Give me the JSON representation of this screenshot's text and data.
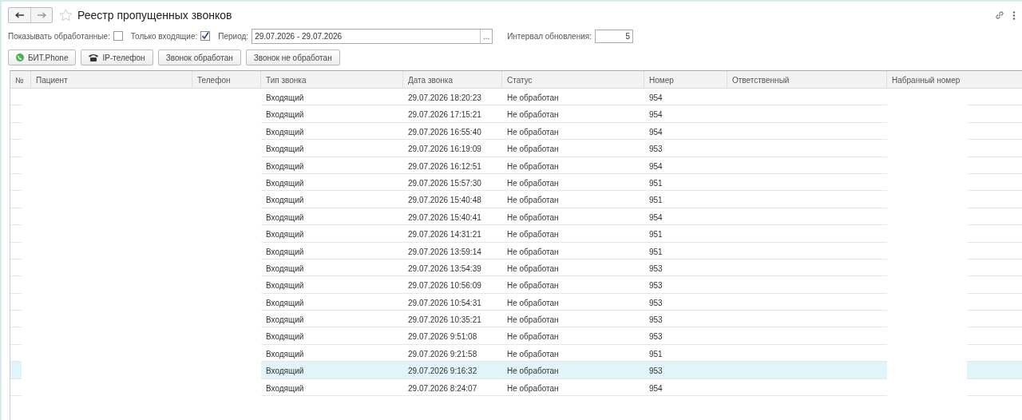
{
  "window": {
    "title": "Реестр пропущенных звонков",
    "favorite": false
  },
  "filters": {
    "show_processed": {
      "label": "Показывать обработанные:",
      "checked": false
    },
    "incoming_only": {
      "label": "Только входящие:",
      "checked": true
    },
    "period": {
      "label": "Период:",
      "value": "29.07.2026 - 29.07.2026",
      "button": "..."
    },
    "refresh": {
      "label": "Интервал обновления:",
      "value": "5"
    }
  },
  "buttons": [
    {
      "label": "БИТ.Phone",
      "kind": "phone"
    },
    {
      "label": "IP-телефон",
      "kind": "telephone"
    },
    {
      "label": "Звонок обработан",
      "kind": "plain"
    },
    {
      "label": "Звонок не обработан",
      "kind": "plain"
    }
  ],
  "table": {
    "columns": [
      "№",
      "Пациент",
      "Телефон",
      "Тип звонка",
      "Дата звонка",
      "Статус",
      "Номер",
      "Ответственный",
      "Набранный номер"
    ],
    "rows": [
      {
        "type": "Входящий",
        "date": "29.07.2026 18:20:23",
        "status": "Не обработан",
        "number": "954",
        "selected": false
      },
      {
        "type": "Входящий",
        "date": "29.07.2026 17:15:21",
        "status": "Не обработан",
        "number": "954",
        "selected": false
      },
      {
        "type": "Входящий",
        "date": "29.07.2026 16:55:40",
        "status": "Не обработан",
        "number": "954",
        "selected": false
      },
      {
        "type": "Входящий",
        "date": "29.07.2026 16:19:09",
        "status": "Не обработан",
        "number": "953",
        "selected": false
      },
      {
        "type": "Входящий",
        "date": "29.07.2026 16:12:51",
        "status": "Не обработан",
        "number": "954",
        "selected": false
      },
      {
        "type": "Входящий",
        "date": "29.07.2026 15:57:30",
        "status": "Не обработан",
        "number": "951",
        "selected": false
      },
      {
        "type": "Входящий",
        "date": "29.07.2026 15:40:48",
        "status": "Не обработан",
        "number": "951",
        "selected": false
      },
      {
        "type": "Входящий",
        "date": "29.07.2026 15:40:41",
        "status": "Не обработан",
        "number": "954",
        "selected": false
      },
      {
        "type": "Входящий",
        "date": "29.07.2026 14:31:21",
        "status": "Не обработан",
        "number": "951",
        "selected": false
      },
      {
        "type": "Входящий",
        "date": "29.07.2026 13:59:14",
        "status": "Не обработан",
        "number": "951",
        "selected": false
      },
      {
        "type": "Входящий",
        "date": "29.07.2026 13:54:39",
        "status": "Не обработан",
        "number": "953",
        "selected": false
      },
      {
        "type": "Входящий",
        "date": "29.07.2026 10:56:09",
        "status": "Не обработан",
        "number": "953",
        "selected": false
      },
      {
        "type": "Входящий",
        "date": "29.07.2026 10:54:31",
        "status": "Не обработан",
        "number": "953",
        "selected": false
      },
      {
        "type": "Входящий",
        "date": "29.07.2026 10:35:21",
        "status": "Не обработан",
        "number": "953",
        "selected": false
      },
      {
        "type": "Входящий",
        "date": "29.07.2026 9:51:08",
        "status": "Не обработан",
        "number": "953",
        "selected": false
      },
      {
        "type": "Входящий",
        "date": "29.07.2026 9:21:58",
        "status": "Не обработан",
        "number": "951",
        "selected": false
      },
      {
        "type": "Входящий",
        "date": "29.07.2026 9:16:32",
        "status": "Не обработан",
        "number": "953",
        "selected": true
      },
      {
        "type": "Входящий",
        "date": "29.07.2026 8:24:07",
        "status": "Не обработан",
        "number": "954",
        "selected": false
      }
    ]
  }
}
